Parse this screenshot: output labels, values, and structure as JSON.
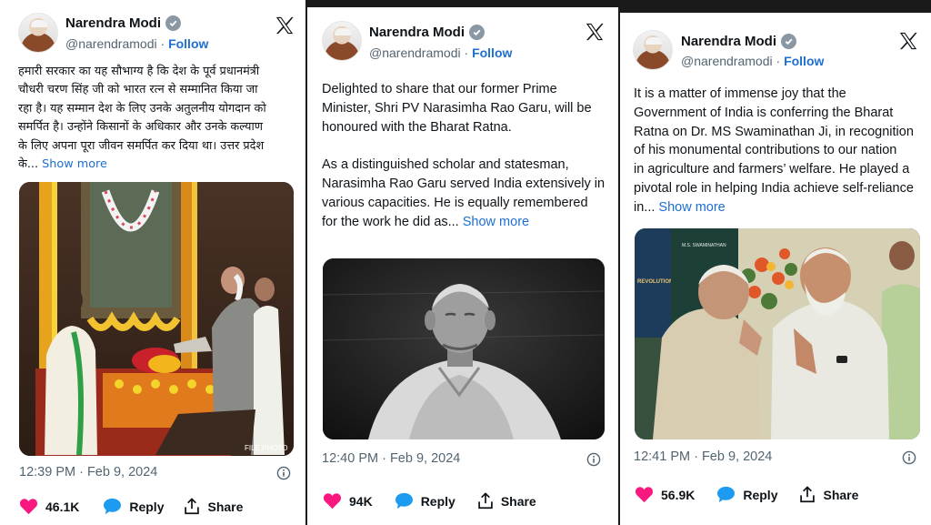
{
  "posts": [
    {
      "author": "Narendra Modi",
      "handle": "@narendramodi",
      "separator": "·",
      "follow": "Follow",
      "text_lines": [
        "हमारी सरकार का यह सौभाग्य है कि देश के पूर्व प्रधानमंत्री",
        "चौधरी चरण सिंह जी को भारत रत्न से सम्मानित किया जा",
        "रहा है। यह सम्मान देश के लिए उनके अतुलनीय योगदान को",
        "समर्पित है। उन्होंने किसानों के अधिकार और उनके कल्याण",
        "के लिए अपना पूरा जीवन समर्पित कर दिया था। उत्तर प्रदेश",
        "के..."
      ],
      "show_more": "Show more",
      "photo_watermark": "FILE PHOTO",
      "time": "12:39 PM · Feb 9, 2024",
      "likes": "46.1K",
      "reply": "Reply",
      "share": "Share"
    },
    {
      "author": "Narendra Modi",
      "handle": "@narendramodi",
      "separator": "·",
      "follow": "Follow",
      "text_lines": [
        "Delighted to share that our former Prime",
        "Minister, Shri PV Narasimha Rao Garu, will be",
        "honoured with the Bharat Ratna.",
        "",
        "As a distinguished scholar and statesman,",
        "Narasimha Rao Garu served India extensively in",
        "various capacities. He is equally remembered",
        "for the work he did as..."
      ],
      "show_more": "Show more",
      "time": "12:40 PM · Feb 9, 2024",
      "likes": "94K",
      "reply": "Reply",
      "share": "Share"
    },
    {
      "author": "Narendra Modi",
      "handle": "@narendramodi",
      "separator": "·",
      "follow": "Follow",
      "text_lines": [
        "It is a matter of immense joy that the",
        "Government of India is conferring the Bharat",
        "Ratna on Dr. MS Swaminathan Ji, in recognition",
        "of his monumental contributions to our nation",
        "in agriculture and farmers’ welfare. He played a",
        "pivotal role in helping India achieve self-reliance",
        "in..."
      ],
      "show_more": "Show more",
      "photo_sign_heading": "M.S. SWAMINATHAN",
      "photo_book_title": "REVOLUTION",
      "time": "12:41 PM · Feb 9, 2024",
      "likes": "56.9K",
      "reply": "Reply",
      "share": "Share"
    }
  ],
  "colors": {
    "link_blue": "#1d6fd1",
    "like_pink": "#f91880",
    "reply_blue": "#1d9bf0",
    "muted_gray": "#536471"
  },
  "icons": [
    "x-logo-icon",
    "verified-badge-icon",
    "heart-icon",
    "reply-bubble-icon",
    "share-icon",
    "info-icon"
  ]
}
